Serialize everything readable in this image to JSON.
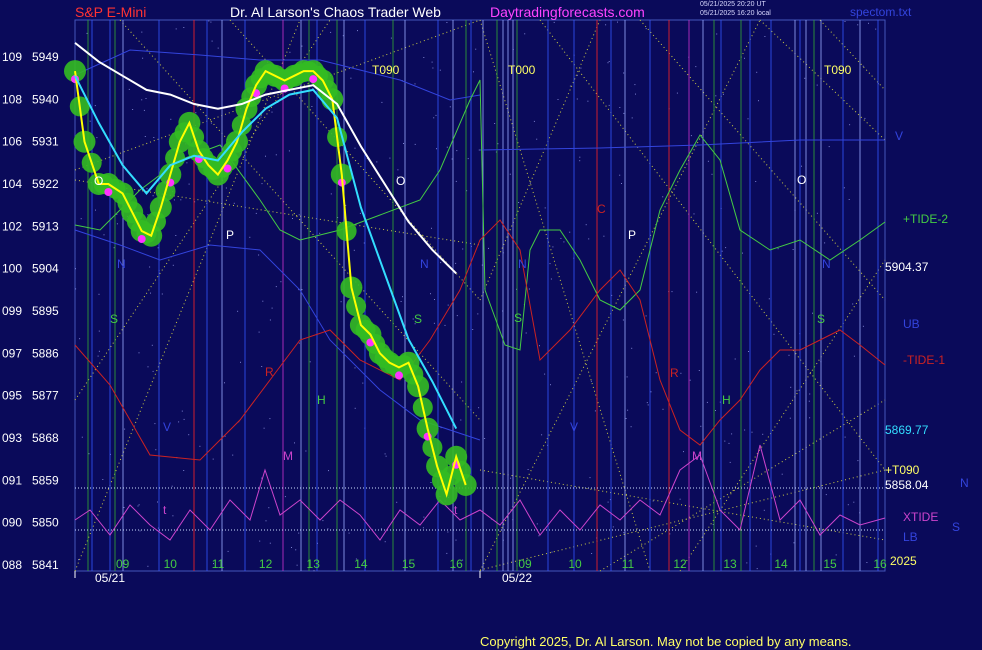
{
  "header": {
    "instrument": "S&P E-Mini",
    "site_title": "Dr. Al Larson's Chaos Trader Web",
    "website": "Daytradingforecasts.com",
    "timestamp_1": "05/21/2025 20:20 UT",
    "timestamp_2": "05/21/2025 16:20 local",
    "file": "spectom.txt"
  },
  "footer": {
    "copyright": "Copyright 2025, Dr. Al Larson. May not be copied by any means."
  },
  "colors": {
    "background": "#0a0a5a",
    "price": "#ffff00",
    "cyan_average": "#33ddff",
    "white_average": "#ffffff",
    "tide_plus": "#44cc44",
    "tide_minus": "#cc2222",
    "xtide": "#cc44cc",
    "bands": "#3344dd",
    "green_ball": "#33bb22",
    "magenta_dot": "#ff33ff"
  },
  "chart_data": {
    "type": "line",
    "title": "S&P E-Mini",
    "xlabel": "",
    "ylabel": "",
    "ylim": [
      5841,
      5949
    ],
    "y_ticks": [
      {
        "left": "109",
        "price": "5949",
        "value": 5949
      },
      {
        "left": "108",
        "price": "5940",
        "value": 5940
      },
      {
        "left": "106",
        "price": "5931",
        "value": 5931
      },
      {
        "left": "104",
        "price": "5922",
        "value": 5922
      },
      {
        "left": "102",
        "price": "5913",
        "value": 5913
      },
      {
        "left": "100",
        "price": "5904",
        "value": 5904
      },
      {
        "left": "099",
        "price": "5895",
        "value": 5895
      },
      {
        "left": "097",
        "price": "5886",
        "value": 5886
      },
      {
        "left": "095",
        "price": "5877",
        "value": 5877
      },
      {
        "left": "093",
        "price": "5868",
        "value": 5868
      },
      {
        "left": "091",
        "price": "5859",
        "value": 5859
      },
      {
        "left": "090",
        "price": "5850",
        "value": 5850
      },
      {
        "left": "088",
        "price": "5841",
        "value": 5841
      }
    ],
    "x_range": [
      8,
      16.5
    ],
    "x_ticks": [
      {
        "label": "09",
        "x": 9
      },
      {
        "label": "10",
        "x": 10
      },
      {
        "label": "11",
        "x": 11
      },
      {
        "label": "12",
        "x": 12
      },
      {
        "label": "13",
        "x": 13
      },
      {
        "label": "14",
        "x": 14
      },
      {
        "label": "15",
        "x": 15
      },
      {
        "label": "16",
        "x": 16
      }
    ],
    "forecast_x_ticks": [
      "09",
      "10",
      "11",
      "12",
      "13",
      "14",
      "15",
      "16"
    ],
    "dates": [
      "05/21",
      "05/22"
    ],
    "series": [
      {
        "name": "",
        "color": "#ffff00",
        "x": [
          8,
          8.2,
          8.5,
          8.7,
          9,
          9.2,
          9.4,
          9.6,
          9.8,
          10,
          10.2,
          10.4,
          10.6,
          10.8,
          11,
          11.2,
          11.4,
          11.6,
          11.8,
          12,
          12.2,
          12.4,
          12.6,
          12.8,
          13,
          13.2,
          13.4,
          13.6,
          13.8,
          14,
          14.2,
          14.4,
          14.6,
          14.8,
          15,
          15.2,
          15.4,
          15.6,
          15.8,
          16,
          16.2
        ],
        "y": [
          5946,
          5931,
          5922,
          5922,
          5920,
          5916,
          5912,
          5911,
          5917,
          5924,
          5931,
          5935,
          5929,
          5926,
          5924,
          5927,
          5931,
          5938,
          5943,
          5946,
          5945,
          5944,
          5945,
          5946,
          5946,
          5944,
          5940,
          5924,
          5900,
          5892,
          5890,
          5886,
          5884,
          5883,
          5884,
          5879,
          5870,
          5862,
          5856,
          5864,
          5858
        ]
      },
      {
        "name": "",
        "color": "#33ddff",
        "x": [
          8,
          8.5,
          9,
          9.5,
          10,
          10.5,
          11,
          11.5,
          12,
          12.5,
          13,
          13.5,
          14,
          14.5,
          15,
          15.5,
          16
        ],
        "y": [
          5945,
          5935,
          5926,
          5920,
          5926,
          5928,
          5927,
          5933,
          5938,
          5941,
          5942,
          5936,
          5917,
          5903,
          5889,
          5880,
          5870
        ]
      },
      {
        "name": "",
        "color": "#ffffff",
        "x": [
          8,
          8.5,
          9,
          9.5,
          10,
          10.5,
          11,
          11.5,
          12,
          12.5,
          13,
          13.5,
          14,
          14.5,
          15,
          15.5,
          16
        ],
        "y": [
          5952,
          5948,
          5945,
          5942,
          5941,
          5939,
          5938,
          5939,
          5941,
          5942,
          5943,
          5939,
          5930,
          5922,
          5914,
          5908,
          5903
        ]
      }
    ],
    "right_labels": [
      {
        "text": "V",
        "color": "#3344dd"
      },
      {
        "text": "+TIDE-2",
        "color": "#44cc44"
      },
      {
        "text": "5904.37",
        "color": "#ffffff"
      },
      {
        "text": "UB",
        "color": "#3344dd"
      },
      {
        "text": "-TIDE-1",
        "color": "#cc2222"
      },
      {
        "text": "5869.77",
        "color": "#33ddff"
      },
      {
        "text": "+T090",
        "color": "#ffff66"
      },
      {
        "text": "5858.04",
        "color": "#ffffff"
      },
      {
        "text": "N",
        "color": "#3344dd"
      },
      {
        "text": "XTIDE",
        "color": "#cc44cc"
      },
      {
        "text": "S",
        "color": "#3344dd"
      },
      {
        "text": "LB",
        "color": "#3344dd"
      },
      {
        "text": "2025",
        "color": "#ffff66"
      }
    ],
    "annotations": [
      {
        "text": "T090",
        "color": "#ffff66"
      },
      {
        "text": "T000",
        "color": "#ffff66"
      },
      {
        "text": "T090",
        "color": "#ffff66"
      },
      {
        "text": "O",
        "color": "#ffffff"
      },
      {
        "text": "O",
        "color": "#ffffff"
      },
      {
        "text": "O",
        "color": "#ffffff"
      },
      {
        "text": "P",
        "color": "#ffffff"
      },
      {
        "text": "P",
        "color": "#ffffff"
      },
      {
        "text": "N",
        "color": "#3344dd"
      },
      {
        "text": "N",
        "color": "#3344dd"
      },
      {
        "text": "N",
        "color": "#3344dd"
      },
      {
        "text": "N",
        "color": "#3344dd"
      },
      {
        "text": "S",
        "color": "#44cc44"
      },
      {
        "text": "S",
        "color": "#44cc44"
      },
      {
        "text": "S",
        "color": "#44cc44"
      },
      {
        "text": "S",
        "color": "#44cc44"
      },
      {
        "text": "C",
        "color": "#cc2222"
      },
      {
        "text": "R",
        "color": "#cc2222"
      },
      {
        "text": "R",
        "color": "#cc2222"
      },
      {
        "text": "M",
        "color": "#cc44cc"
      },
      {
        "text": "M",
        "color": "#cc44cc"
      },
      {
        "text": "H",
        "color": "#44cc44"
      },
      {
        "text": "H",
        "color": "#44cc44"
      },
      {
        "text": "V",
        "color": "#3344dd"
      },
      {
        "text": "V",
        "color": "#3344dd"
      },
      {
        "text": "t",
        "color": "#cc44cc"
      },
      {
        "text": "t",
        "color": "#cc44cc"
      }
    ]
  }
}
